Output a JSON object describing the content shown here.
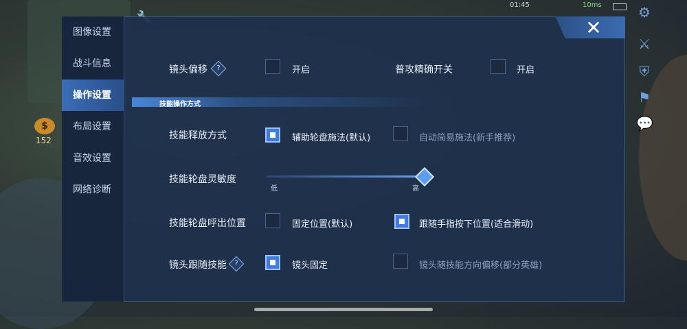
{
  "status": {
    "time": "01:45",
    "ms": "10ms"
  },
  "sidebar": {
    "items": [
      {
        "label": "图像设置",
        "active": false
      },
      {
        "label": "战斗信息",
        "active": false
      },
      {
        "label": "操作设置",
        "active": true
      },
      {
        "label": "布局设置",
        "active": false
      },
      {
        "label": "音效设置",
        "active": false
      },
      {
        "label": "网络诊断",
        "active": false
      }
    ]
  },
  "hud": {
    "gold": "152"
  },
  "close_label": "✕",
  "rows": {
    "camera_offset": {
      "label": "镜头偏移",
      "help": "?",
      "option": "开启",
      "checked": false
    },
    "precise_switch": {
      "label": "普攻精确开关",
      "option": "开启",
      "checked": false
    },
    "section_title": "技能操作方式",
    "skill_mode": {
      "label": "技能释放方式",
      "options": [
        {
          "text": "辅助轮盘施法(默认)",
          "checked": true
        },
        {
          "text": "自动简易施法(新手推荐)",
          "checked": false
        }
      ]
    },
    "sensitivity": {
      "label": "技能轮盘灵敏度",
      "low": "低",
      "high": "高",
      "value": 1.0
    },
    "wheel_position": {
      "label": "技能轮盘呼出位置",
      "options": [
        {
          "text": "固定位置(默认)",
          "checked": false
        },
        {
          "text": "跟随手指按下位置(适合滑动)",
          "checked": true
        }
      ]
    },
    "camera_follow": {
      "label": "镜头跟随技能",
      "help": "?",
      "options": [
        {
          "text": "镜头固定",
          "checked": true
        },
        {
          "text": "镜头随技能方向偏移(部分英雄)",
          "checked": false
        }
      ]
    }
  }
}
